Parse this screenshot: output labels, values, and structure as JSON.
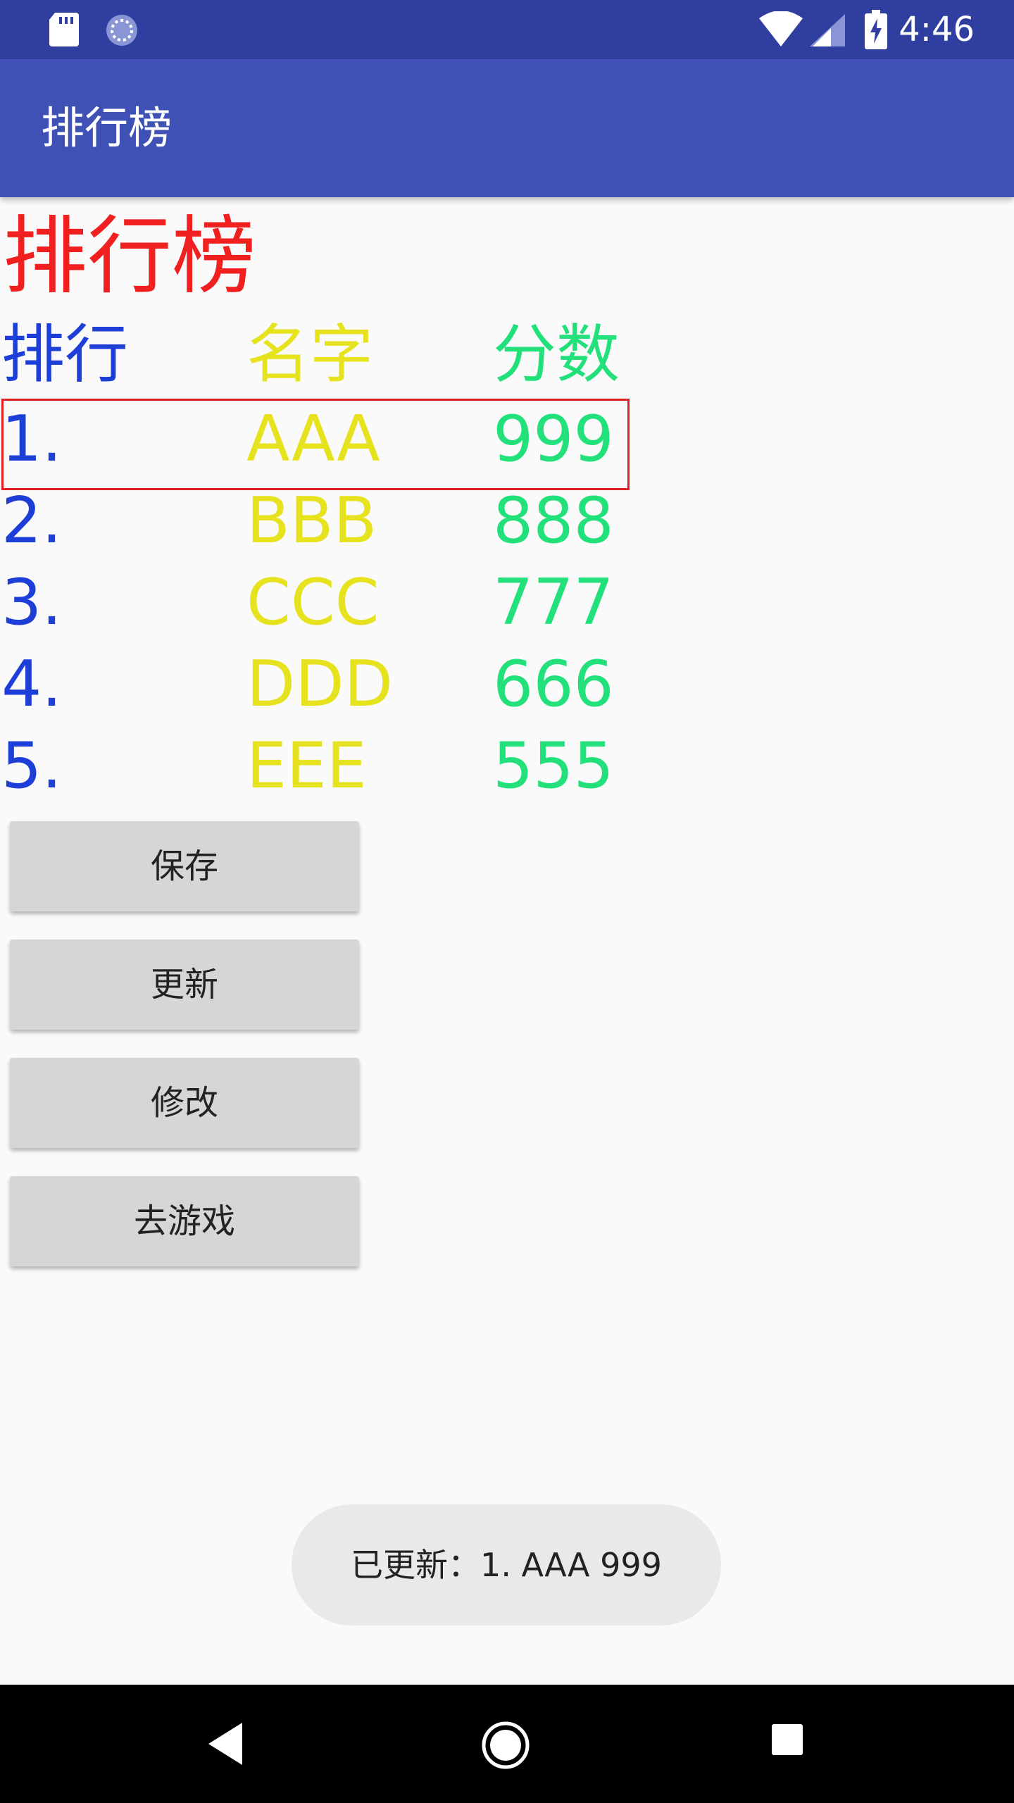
{
  "status_bar": {
    "time": "4:46"
  },
  "app_bar": {
    "title": "排行榜"
  },
  "heading": "排行榜",
  "columns": {
    "rank": "排行",
    "name": "名字",
    "score": "分数"
  },
  "rows": [
    {
      "rank": "1.",
      "name": "AAA",
      "score": "999"
    },
    {
      "rank": "2.",
      "name": "BBB",
      "score": "888"
    },
    {
      "rank": "3.",
      "name": "CCC",
      "score": "777"
    },
    {
      "rank": "4.",
      "name": "DDD",
      "score": "666"
    },
    {
      "rank": "5.",
      "name": "EEE",
      "score": "555"
    }
  ],
  "buttons": {
    "save": "保存",
    "update": "更新",
    "modify": "修改",
    "play": "去游戏"
  },
  "toast": "已更新：1. AAA 999",
  "colors": {
    "status_bar": "#303f9f",
    "app_bar": "#3f51b5",
    "heading": "#f02020",
    "rank": "#1e3ed8",
    "name": "#e6e21e",
    "score": "#22e07a",
    "highlight_border": "#e02020"
  }
}
